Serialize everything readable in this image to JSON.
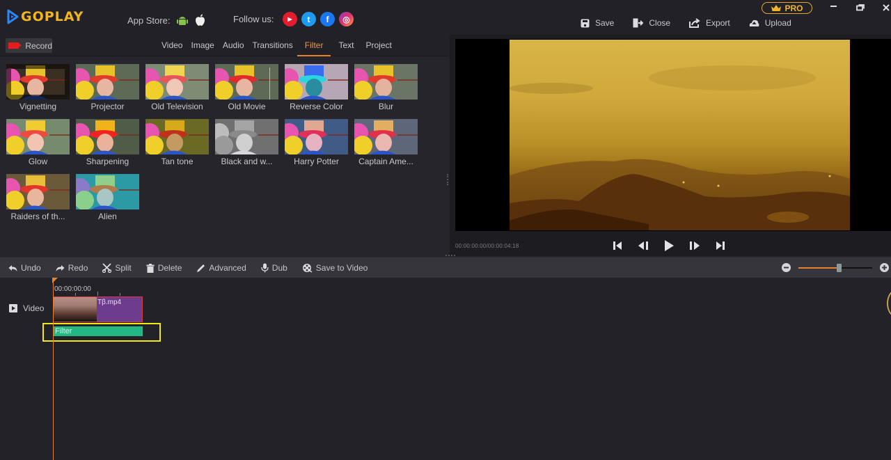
{
  "app": {
    "name": "GOPLAY",
    "brand_color": "#f3b51c",
    "accent_color": "#e5822b"
  },
  "header": {
    "app_store_label": "App Store:",
    "app_store_icons": [
      "android-icon",
      "apple-icon"
    ],
    "follow_label": "Follow us:",
    "social": [
      {
        "name": "youtube-icon",
        "glyph": "▶",
        "color": "#e11e2d"
      },
      {
        "name": "twitter-icon",
        "glyph": "t",
        "color": "#1d9bf0"
      },
      {
        "name": "facebook-icon",
        "glyph": "f",
        "color": "#1a77f2"
      },
      {
        "name": "instagram-icon",
        "glyph": "◎",
        "color": "#d6336c"
      }
    ],
    "pro_label": "PRO",
    "actions": [
      {
        "label": "Save",
        "icon": "floppy-disk-icon"
      },
      {
        "label": "Close",
        "icon": "exit-icon"
      },
      {
        "label": "Export",
        "icon": "export-icon"
      },
      {
        "label": "Upload",
        "icon": "upload-cloud-icon"
      }
    ]
  },
  "left_panel": {
    "record_label": "Record",
    "tabs": [
      "Video",
      "Image",
      "Audio",
      "Transitions",
      "Filter",
      "Text",
      "Project"
    ],
    "active_tab": "Filter",
    "filters": [
      "Vignetting",
      "Projector",
      "Old Television",
      "Old Movie",
      "Reverse Color",
      "Blur",
      "Glow",
      "Sharpening",
      "Tan tone",
      "Black and w...",
      "Harry Potter",
      "Captain Ame...",
      "Raiders of th...",
      "Alien"
    ]
  },
  "preview": {
    "timecode": "00:00:00:00/00:00:04:18",
    "controls": [
      "skip-to-start-icon",
      "step-back-icon",
      "play-icon",
      "step-forward-icon",
      "skip-to-end-icon"
    ]
  },
  "toolbar": {
    "tools": [
      {
        "label": "Undo",
        "icon": "undo-icon"
      },
      {
        "label": "Redo",
        "icon": "redo-icon"
      },
      {
        "label": "Split",
        "icon": "scissors-icon"
      },
      {
        "label": "Delete",
        "icon": "trash-icon"
      },
      {
        "label": "Advanced",
        "icon": "pencil-icon"
      },
      {
        "label": "Dub",
        "icon": "microphone-icon"
      },
      {
        "label": "Save to Video",
        "icon": "film-reel-icon"
      }
    ],
    "zoom_level": 0.55
  },
  "timeline": {
    "ruler_start": "00:00:00:00",
    "track_label": "Video",
    "clip_name": "Tβ.mp4",
    "filter_clip_label": "Filter"
  }
}
